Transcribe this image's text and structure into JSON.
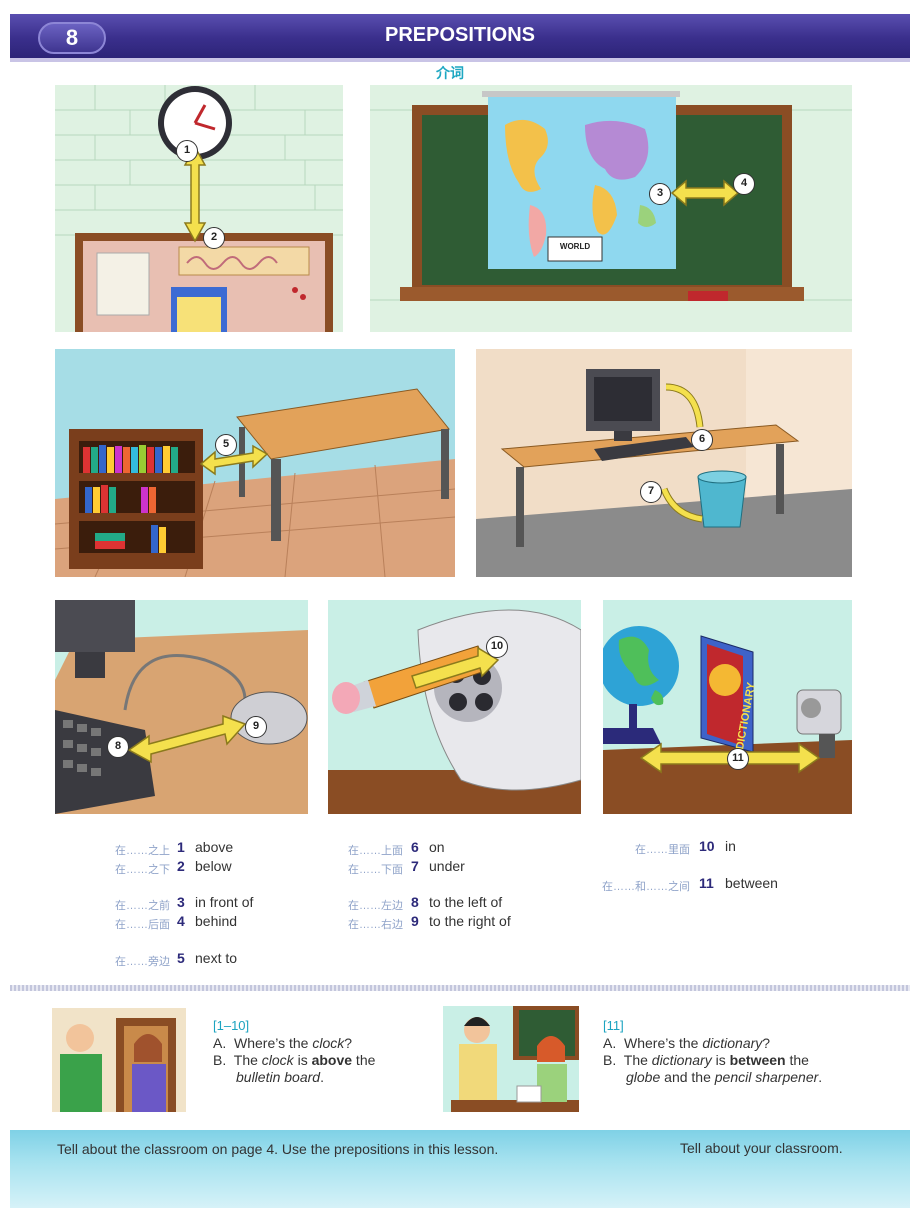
{
  "header": {
    "page_number": "8",
    "title": "PREPOSITIONS",
    "subtitle_zh": "介词"
  },
  "scenes": {
    "clock_board": {
      "markers": [
        "1",
        "2"
      ],
      "board_sign": ""
    },
    "map": {
      "markers": [
        "3",
        "4"
      ],
      "map_label": "WORLD"
    },
    "bookcase": {
      "markers": [
        "5"
      ]
    },
    "computer_desk": {
      "markers": [
        "6",
        "7"
      ]
    },
    "mouse_keyboard": {
      "markers": [
        "8",
        "9"
      ]
    },
    "sharpener": {
      "markers": [
        "10"
      ]
    },
    "globe_dictionary": {
      "markers": [
        "11"
      ],
      "book_label": "DICTIONARY"
    }
  },
  "vocabulary": {
    "col1": [
      {
        "zh": "在……之上",
        "num": "1",
        "word": "above"
      },
      {
        "zh": "在……之下",
        "num": "2",
        "word": "below"
      },
      {
        "zh": "在……之前",
        "num": "3",
        "word": "in front of"
      },
      {
        "zh": "在……后面",
        "num": "4",
        "word": "behind"
      },
      {
        "zh": "在……旁边",
        "num": "5",
        "word": "next to"
      }
    ],
    "col2": [
      {
        "zh": "在……上面",
        "num": "6",
        "word": "on"
      },
      {
        "zh": "在……下面",
        "num": "7",
        "word": "under"
      },
      {
        "zh": "在……左边",
        "num": "8",
        "word": "to the left of"
      },
      {
        "zh": "在……右边",
        "num": "9",
        "word": "to the right of"
      }
    ],
    "col3": [
      {
        "zh": "在……里面",
        "num": "10",
        "word": "in"
      },
      {
        "zh": "在……和……之间",
        "num": "11",
        "word": "between"
      }
    ]
  },
  "dialogs": {
    "left": {
      "range": "[1–10]",
      "a_prefix": "A.",
      "a_text1": "Where’s the ",
      "a_italic": "clock",
      "a_text2": "?",
      "b_prefix": "B.",
      "b_text1": "The ",
      "b_italic1": "clock",
      "b_text2": " is ",
      "b_bold": "above",
      "b_text3": " the",
      "b_line2_italic": "bulletin board",
      "b_line2_end": "."
    },
    "right": {
      "range": "[11]",
      "a_prefix": "A.",
      "a_text1": "Where’s the ",
      "a_italic": "dictionary",
      "a_text2": "?",
      "b_prefix": "B.",
      "b_text1": "The ",
      "b_italic1": "dictionary",
      "b_text2": " is ",
      "b_bold": "between",
      "b_text3": " the",
      "b_line2_italic1": "globe",
      "b_line2_mid": " and the ",
      "b_line2_italic2": "pencil sharpener",
      "b_line2_end": "."
    }
  },
  "footer": {
    "left_text": "Tell about the classroom on page 4.  Use the prepositions in this lesson.",
    "right_text": "Tell about your classroom."
  },
  "colors": {
    "header_purple": "#3a2f8c",
    "accent_cyan": "#1da7c2",
    "arrow_yellow": "#f4e04d",
    "number_navy": "#2d2a7a"
  }
}
